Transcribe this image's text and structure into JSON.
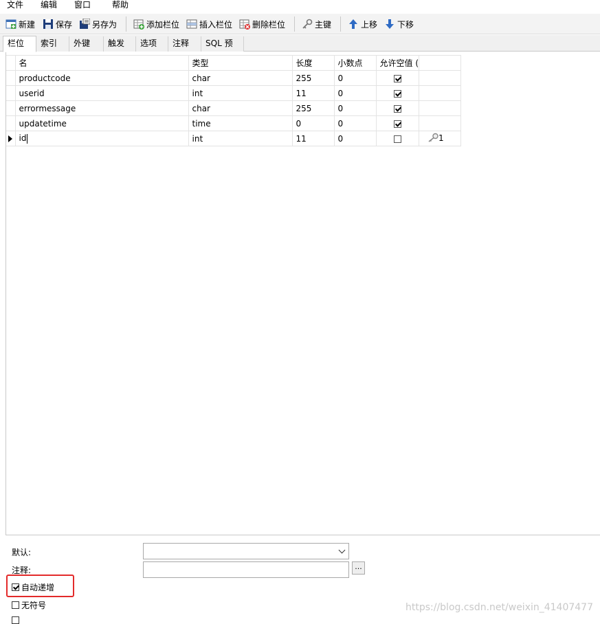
{
  "menu": [
    "文件",
    "编辑",
    "窗口",
    "帮助"
  ],
  "toolbar": {
    "new_label": "新建",
    "save_label": "保存",
    "save_as_label": "另存为",
    "add_column_label": "添加栏位",
    "insert_column_label": "插入栏位",
    "delete_column_label": "删除栏位",
    "primary_key_label": "主键",
    "move_up_label": "上移",
    "move_down_label": "下移"
  },
  "tabs": [
    "栏位",
    "索引",
    "外键",
    "触发器",
    "选项",
    "注释",
    "SQL 预览"
  ],
  "grid": {
    "headers": [
      "名",
      "类型",
      "长度",
      "小数点",
      "允许空值 ("
    ],
    "rows": [
      {
        "name": "productcode",
        "type": "char",
        "length": "255",
        "decimals": "0",
        "nullable": true,
        "key": ""
      },
      {
        "name": "userid",
        "type": "int",
        "length": "11",
        "decimals": "0",
        "nullable": true,
        "key": ""
      },
      {
        "name": "errormessage",
        "type": "char",
        "length": "255",
        "decimals": "0",
        "nullable": true,
        "key": ""
      },
      {
        "name": "updatetime",
        "type": "time",
        "length": "0",
        "decimals": "0",
        "nullable": true,
        "key": ""
      },
      {
        "name": "id",
        "type": "int",
        "length": "11",
        "decimals": "0",
        "nullable": false,
        "key": "1"
      }
    ]
  },
  "properties": {
    "default_label": "默认:",
    "default_value": "",
    "comment_label": "注释:",
    "comment_value": "",
    "ellipsis_label": "...",
    "auto_increment_label": "自动递增",
    "auto_increment_checked": true,
    "unsigned_label": "无符号",
    "unsigned_checked": false
  },
  "watermark": "https://blog.csdn.net/weixin_41407477",
  "colors": {
    "highlight": "#e32a2a",
    "toolbar_bg": "#f3f3f3"
  }
}
